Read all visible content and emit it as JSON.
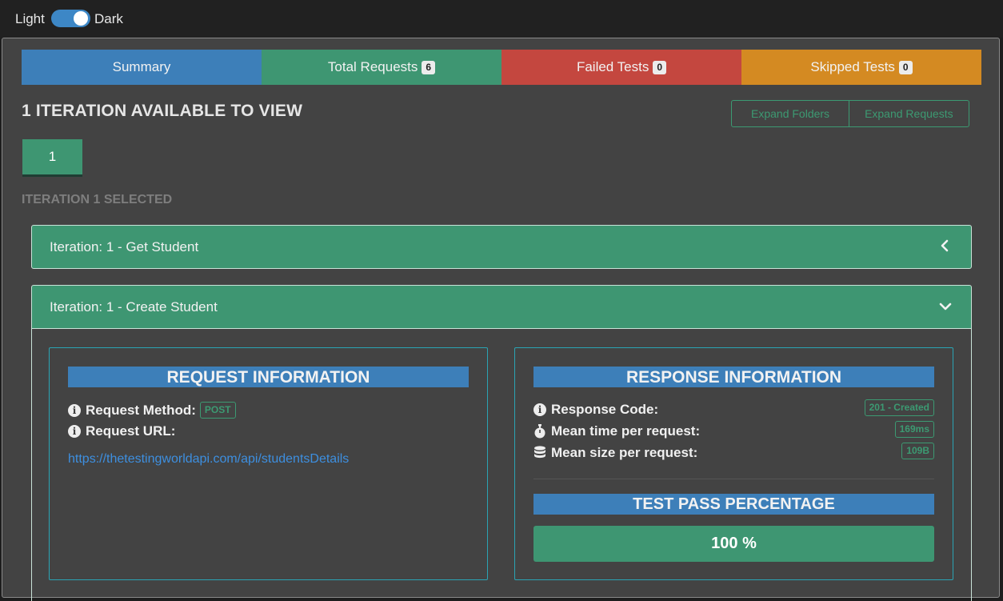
{
  "theme": {
    "light_label": "Light",
    "dark_label": "Dark",
    "selected": "Dark"
  },
  "tabs": [
    {
      "label": "Summary",
      "badge": "",
      "color": "#3d7fb9"
    },
    {
      "label": "Total Requests",
      "badge": "6",
      "color": "#3e9672"
    },
    {
      "label": "Failed Tests",
      "badge": "0",
      "color": "#c4473f"
    },
    {
      "label": "Skipped Tests",
      "badge": "0",
      "color": "#d48a22"
    }
  ],
  "heading": "1 ITERATION AVAILABLE TO VIEW",
  "expand": {
    "folders": "Expand Folders",
    "requests": "Expand Requests"
  },
  "iteration_button": "1",
  "selected_label": "ITERATION 1 SELECTED",
  "panels": [
    {
      "title": "Iteration: 1 - Get Student",
      "icon": "chevron-left-icon"
    },
    {
      "title": "Iteration: 1 - Create Student",
      "icon": "chevron-down-icon"
    }
  ],
  "request": {
    "title": "REQUEST INFORMATION",
    "method_label": "Request Method:",
    "method_value": "POST",
    "url_label": "Request URL:",
    "url": "https://thetestingworldapi.com/api/studentsDetails"
  },
  "response": {
    "title": "RESPONSE INFORMATION",
    "code_label": "Response Code:",
    "code_value": "201 - Created",
    "time_label": "Mean time per request:",
    "time_value": "169ms",
    "size_label": "Mean size per request:",
    "size_value": "109B"
  },
  "test_pass": {
    "title": "TEST PASS PERCENTAGE",
    "value": "100 %"
  }
}
